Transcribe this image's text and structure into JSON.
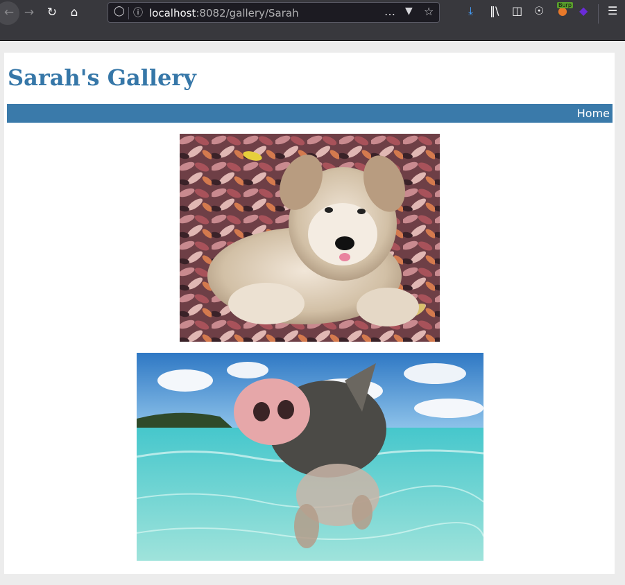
{
  "browser": {
    "url_host": "localhost",
    "url_path": ":8082/gallery/Sarah",
    "icons": {
      "back": "arrow-left-icon",
      "forward": "arrow-right-icon",
      "reload": "reload-icon",
      "home": "home-icon",
      "shield": "shield-icon",
      "info": "info-icon",
      "more": "ellipsis-icon",
      "pocket": "pocket-icon",
      "bookmark": "star-icon",
      "downloads": "download-icon",
      "library": "library-icon",
      "sidebar": "sidebar-icon",
      "account": "account-icon",
      "burp": "burp-extension-icon",
      "extension": "extension-icon",
      "menu": "hamburger-menu-icon"
    },
    "burp_label": "Burp"
  },
  "page": {
    "title": "Sarah's Gallery",
    "nav": {
      "home_label": "Home"
    },
    "images": [
      {
        "subject": "puppy lying in autumn leaves"
      },
      {
        "subject": "pig swimming in turquoise water"
      }
    ]
  },
  "colors": {
    "title": "#3677a8",
    "navbar": "#3a7aaa",
    "page_bg": "#ececec"
  }
}
